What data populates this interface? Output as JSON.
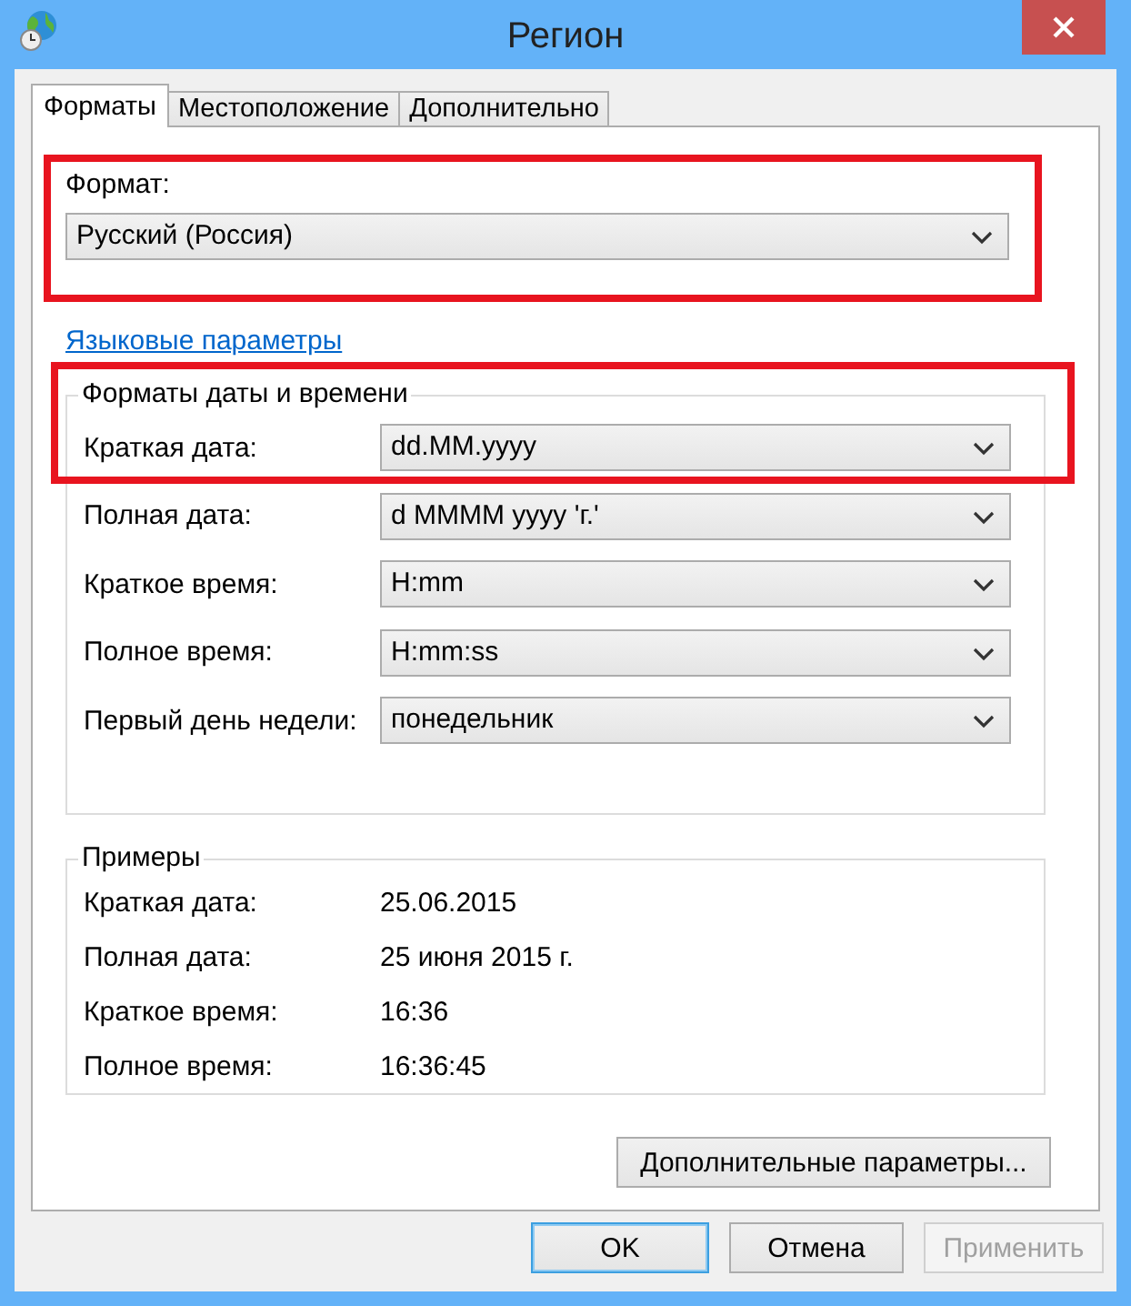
{
  "window": {
    "title": "Регион"
  },
  "tabs": [
    {
      "label": "Форматы",
      "selected": true
    },
    {
      "label": "Местоположение",
      "selected": false
    },
    {
      "label": "Дополнительно",
      "selected": false
    }
  ],
  "format": {
    "label": "Формат:",
    "value": "Русский (Россия)",
    "highlighted": true
  },
  "language_link": "Языковые параметры",
  "date_time_formats": {
    "title": "Форматы даты и времени",
    "rows": [
      {
        "label": "Краткая дата:",
        "value": "dd.MM.yyyy",
        "highlighted": true
      },
      {
        "label": "Полная дата:",
        "value": "d MMMM yyyy 'г.'",
        "highlighted": false
      },
      {
        "label": "Краткое время:",
        "value": "H:mm",
        "highlighted": false
      },
      {
        "label": "Полное время:",
        "value": "H:mm:ss",
        "highlighted": false
      },
      {
        "label": "Первый день недели:",
        "value": "понедельник",
        "highlighted": false
      }
    ]
  },
  "examples": {
    "title": "Примеры",
    "rows": [
      {
        "label": "Краткая дата:",
        "value": "25.06.2015"
      },
      {
        "label": "Полная дата:",
        "value": "25 июня 2015 г."
      },
      {
        "label": "Краткое время:",
        "value": "16:36"
      },
      {
        "label": "Полное время:",
        "value": "16:36:45"
      }
    ]
  },
  "advanced_button": "Дополнительные параметры...",
  "buttons": [
    {
      "label": "OK",
      "default": true,
      "disabled": false
    },
    {
      "label": "Отмена",
      "default": false,
      "disabled": false
    },
    {
      "label": "Применить",
      "default": false,
      "disabled": true
    }
  ]
}
